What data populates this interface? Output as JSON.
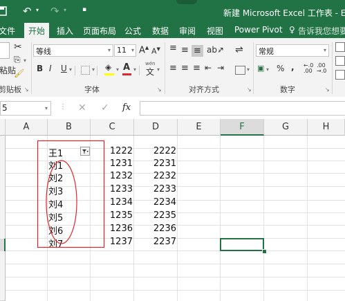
{
  "title_bar": {
    "title": "新建 Microsoft Excel 工作表 - Exc"
  },
  "ribbon_tabs": {
    "file": "文件",
    "items": [
      "开始",
      "插入",
      "页面布局",
      "公式",
      "数据",
      "审阅",
      "视图",
      "Power Pivot"
    ],
    "tell_me": "告诉我您想要"
  },
  "ribbon": {
    "clipboard": {
      "paste_label": "粘贴",
      "group_label": "剪贴板"
    },
    "font": {
      "font_name": "等线",
      "font_size": "11",
      "bold": "B",
      "italic": "I",
      "underline": "U",
      "grow": "A",
      "shrink": "A",
      "wen": "wén",
      "wen_char": "文",
      "group_label": "字体"
    },
    "alignment": {
      "group_label": "对齐方式"
    },
    "number": {
      "format": "常规",
      "percent": "%",
      "comma": ",",
      "group_label": "数字"
    }
  },
  "formula_bar": {
    "name_box": "5",
    "fx": "fx",
    "cancel": "✕",
    "confirm": "✓",
    "content": ""
  },
  "sheet": {
    "columns": [
      "A",
      "B",
      "C",
      "D",
      "E",
      "F",
      "G",
      "H"
    ],
    "selected_column": "F",
    "rows": [
      {
        "b": "王1",
        "c": "1222",
        "d": "2222"
      },
      {
        "b": "刘1",
        "c": "1231",
        "d": "2231"
      },
      {
        "b": "刘2",
        "c": "1232",
        "d": "2232"
      },
      {
        "b": "刘3",
        "c": "1233",
        "d": "2233"
      },
      {
        "b": "刘4",
        "c": "1234",
        "d": "2234"
      },
      {
        "b": "刘5",
        "c": "1235",
        "d": "2235"
      },
      {
        "b": "刘6",
        "c": "1236",
        "d": "2236"
      },
      {
        "b": "刘7",
        "c": "1237",
        "d": "2237"
      }
    ],
    "annotation_color": "#e0262b",
    "accent": "#217346"
  }
}
